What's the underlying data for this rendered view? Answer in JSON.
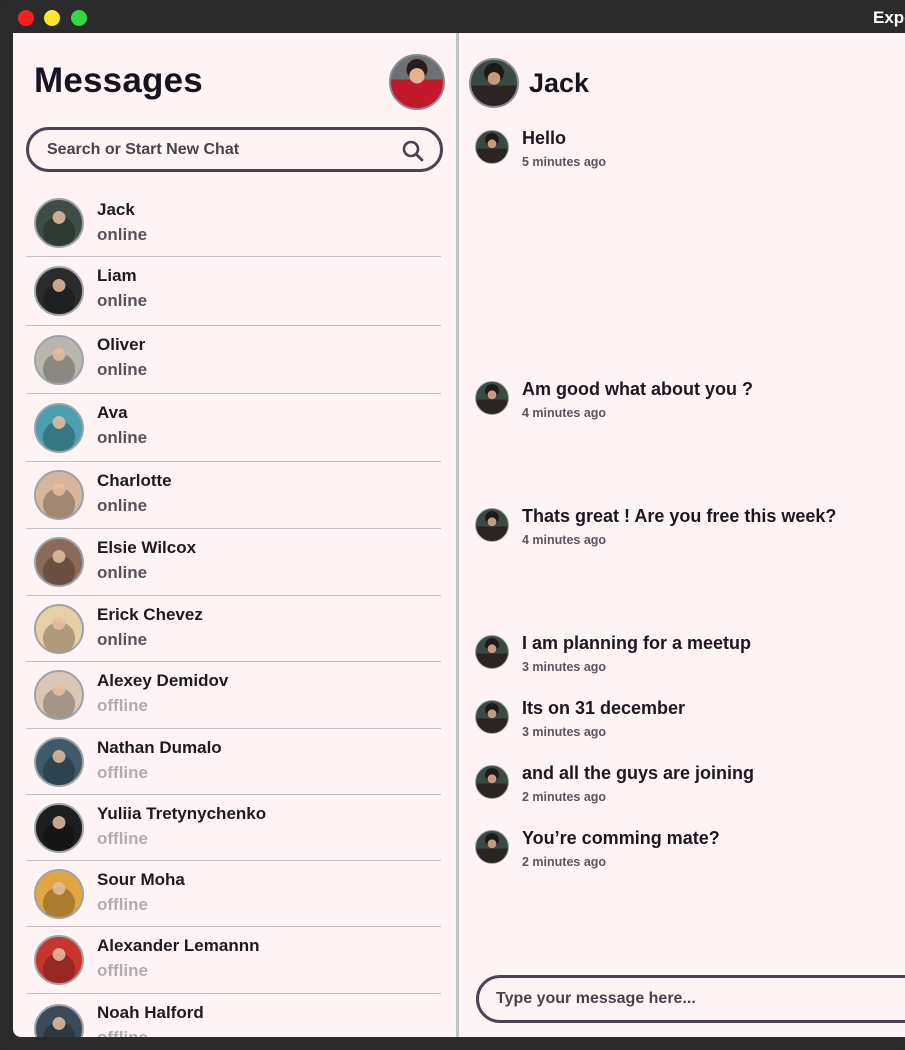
{
  "window": {
    "title": "Expo"
  },
  "sidebar": {
    "title": "Messages",
    "search_placeholder": "Search or Start New Chat",
    "contacts": [
      {
        "name": "Jack",
        "status": "online",
        "avatar_color": "#3f4d45"
      },
      {
        "name": "Liam",
        "status": "online",
        "avatar_color": "#2b2b2b"
      },
      {
        "name": "Oliver",
        "status": "online",
        "avatar_color": "#b9b6ad"
      },
      {
        "name": "Ava",
        "status": "online",
        "avatar_color": "#4a9fb0"
      },
      {
        "name": "Charlotte",
        "status": "online",
        "avatar_color": "#d7b59a"
      },
      {
        "name": "Elsie Wilcox",
        "status": "online",
        "avatar_color": "#8c6a5a"
      },
      {
        "name": "Erick Chevez",
        "status": "online",
        "avatar_color": "#e7cfa6"
      },
      {
        "name": "Alexey Demidov",
        "status": "offline",
        "avatar_color": "#d9c7b6"
      },
      {
        "name": "Nathan Dumalo",
        "status": "offline",
        "avatar_color": "#3e5a6b"
      },
      {
        "name": "Yuliia Tretynychenko",
        "status": "offline",
        "avatar_color": "#1e1e1e"
      },
      {
        "name": "Sour Moha",
        "status": "offline",
        "avatar_color": "#e2a640"
      },
      {
        "name": "Alexander Lemannn",
        "status": "offline",
        "avatar_color": "#c9352d"
      },
      {
        "name": "Noah Halford",
        "status": "offline",
        "avatar_color": "#3b4a58"
      }
    ]
  },
  "chat": {
    "name": "Jack",
    "messages": [
      {
        "text": "Hello",
        "time": "5 minutes ago"
      },
      {
        "text": "Am good what about you ?",
        "time": "4 minutes ago"
      },
      {
        "text": "Thats great ! Are you free this week?",
        "time": "4 minutes ago"
      },
      {
        "text": "I am planning for a meetup",
        "time": "3 minutes ago"
      },
      {
        "text": "Its on 31 december",
        "time": "3 minutes ago"
      },
      {
        "text": "and all the guys are joining",
        "time": "2 minutes ago"
      },
      {
        "text": "You’re comming mate?",
        "time": "2 minutes ago"
      }
    ],
    "input_placeholder": "Type your message here..."
  },
  "colors": {
    "background": "#fff4f5",
    "text": "#15141f",
    "offline": "#b1acb3",
    "online": "#56525b",
    "border": "#4a4455"
  }
}
